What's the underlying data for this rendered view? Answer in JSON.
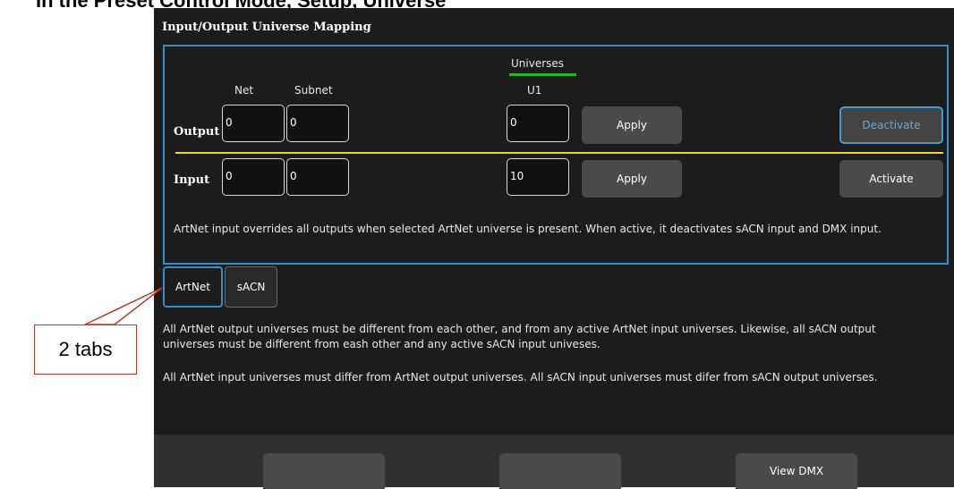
{
  "caption": "2 tabs",
  "top_caption": "In the Preset Control Mode, Setup, Universe",
  "title": "Input/Output Universe Mapping",
  "headers": {
    "universes": "Universes",
    "net": "Net",
    "subnet": "Subnet",
    "u1": "U1"
  },
  "output": {
    "label": "Output",
    "net": "0",
    "subnet": "0",
    "u1": "0",
    "apply": "Apply",
    "toggle": "Deactivate"
  },
  "input": {
    "label": "Input",
    "net": "0",
    "subnet": "0",
    "u1": "10",
    "apply": "Apply",
    "toggle": "Activate"
  },
  "note": "ArtNet input overrides all outputs when selected ArtNet universe is present. When active, it deactivates sACN input and DMX input.",
  "tabs": [
    {
      "label": "ArtNet",
      "active": true
    },
    {
      "label": "sACN",
      "active": false
    }
  ],
  "para1_line1": "All ArtNet output universes must be different from each other, and from any active ArtNet input universes. Likewise, all sACN output",
  "para1_line2": "universes must be different from eash other and any active sACN input univeses.",
  "para2": "All ArtNet input universes must differ from ArtNet output universes. All sACN input universes must difer from sACN output universes.",
  "softkeys": [
    "",
    "",
    "View DMX"
  ],
  "colors": {
    "panel_border": "#3a8ec7",
    "universe_underline": "#22b52a",
    "separator": "#e7dd2a",
    "callout_border": "#c0392b"
  }
}
